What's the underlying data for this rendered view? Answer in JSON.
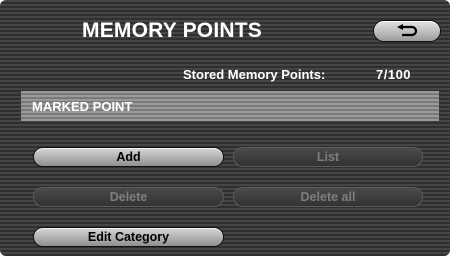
{
  "header": {
    "title": "MEMORY POINTS",
    "back_icon": "return-arrow-icon"
  },
  "status": {
    "label": "Stored Memory Points:",
    "value": "7/100"
  },
  "selected_point": {
    "label": "MARKED POINT"
  },
  "buttons": {
    "add": "Add",
    "list": "List",
    "delete": "Delete",
    "delete_all": "Delete all",
    "edit_category": "Edit Category"
  }
}
